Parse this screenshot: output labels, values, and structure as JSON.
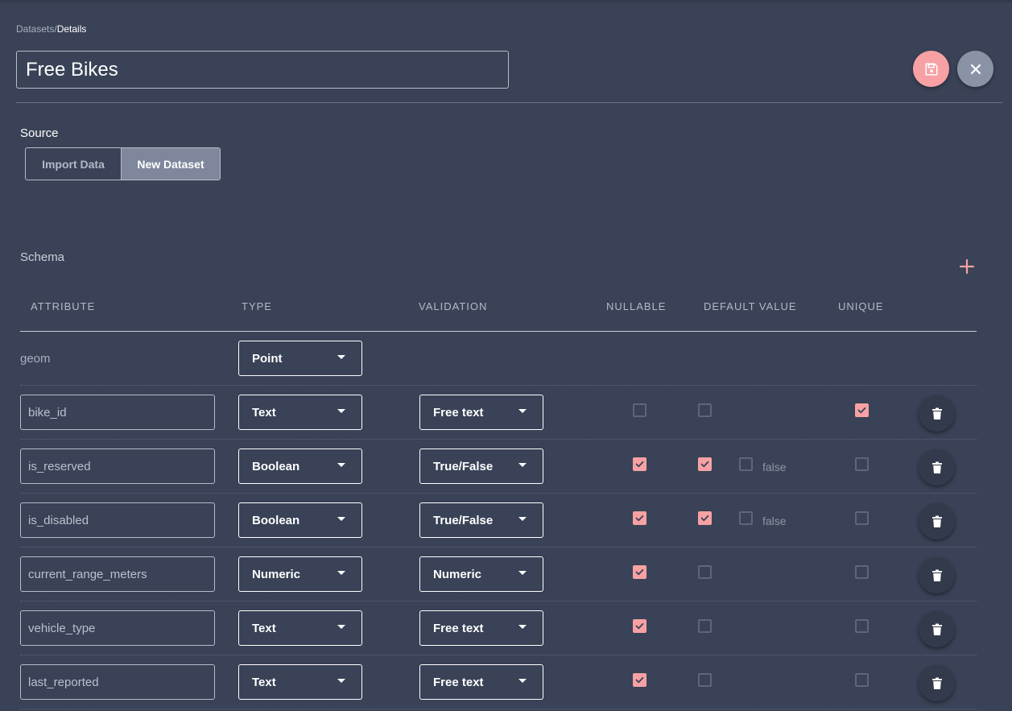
{
  "breadcrumb": {
    "parent": "Datasets",
    "separator": "/",
    "current": "Details"
  },
  "dataset_name": "Free Bikes",
  "source": {
    "label": "Source",
    "options": [
      {
        "label": "Import Data",
        "selected": false
      },
      {
        "label": "New Dataset",
        "selected": true
      }
    ]
  },
  "schema": {
    "label": "Schema",
    "columns": [
      "ATTRIBUTE",
      "TYPE",
      "VALIDATION",
      "NULLABLE",
      "DEFAULT VALUE",
      "UNIQUE"
    ],
    "geom": {
      "name": "geom",
      "type": "Point"
    },
    "rows": [
      {
        "name": "bike_id",
        "type": "Text",
        "validation": "Free text",
        "nullable": false,
        "has_default": false,
        "default_value": "",
        "unique": true
      },
      {
        "name": "is_reserved",
        "type": "Boolean",
        "validation": "True/False",
        "nullable": true,
        "has_default": true,
        "default_checked": false,
        "default_value": "false",
        "unique": false
      },
      {
        "name": "is_disabled",
        "type": "Boolean",
        "validation": "True/False",
        "nullable": true,
        "has_default": true,
        "default_checked": false,
        "default_value": "false",
        "unique": false
      },
      {
        "name": "current_range_meters",
        "type": "Numeric",
        "validation": "Numeric",
        "nullable": true,
        "has_default": false,
        "default_value": "",
        "unique": false
      },
      {
        "name": "vehicle_type",
        "type": "Text",
        "validation": "Free text",
        "nullable": true,
        "has_default": false,
        "default_value": "",
        "unique": false
      },
      {
        "name": "last_reported",
        "type": "Text",
        "validation": "Free text",
        "nullable": true,
        "has_default": false,
        "default_value": "",
        "unique": false
      }
    ]
  },
  "icons": {
    "save": "floppy-disk-icon",
    "close": "close-icon",
    "add": "plus-icon",
    "delete": "trash-icon",
    "dropdown": "caret-down-icon"
  },
  "colors": {
    "background": "#394256",
    "accent": "#f7a1a4",
    "secondary_fab": "#8a93a6"
  }
}
